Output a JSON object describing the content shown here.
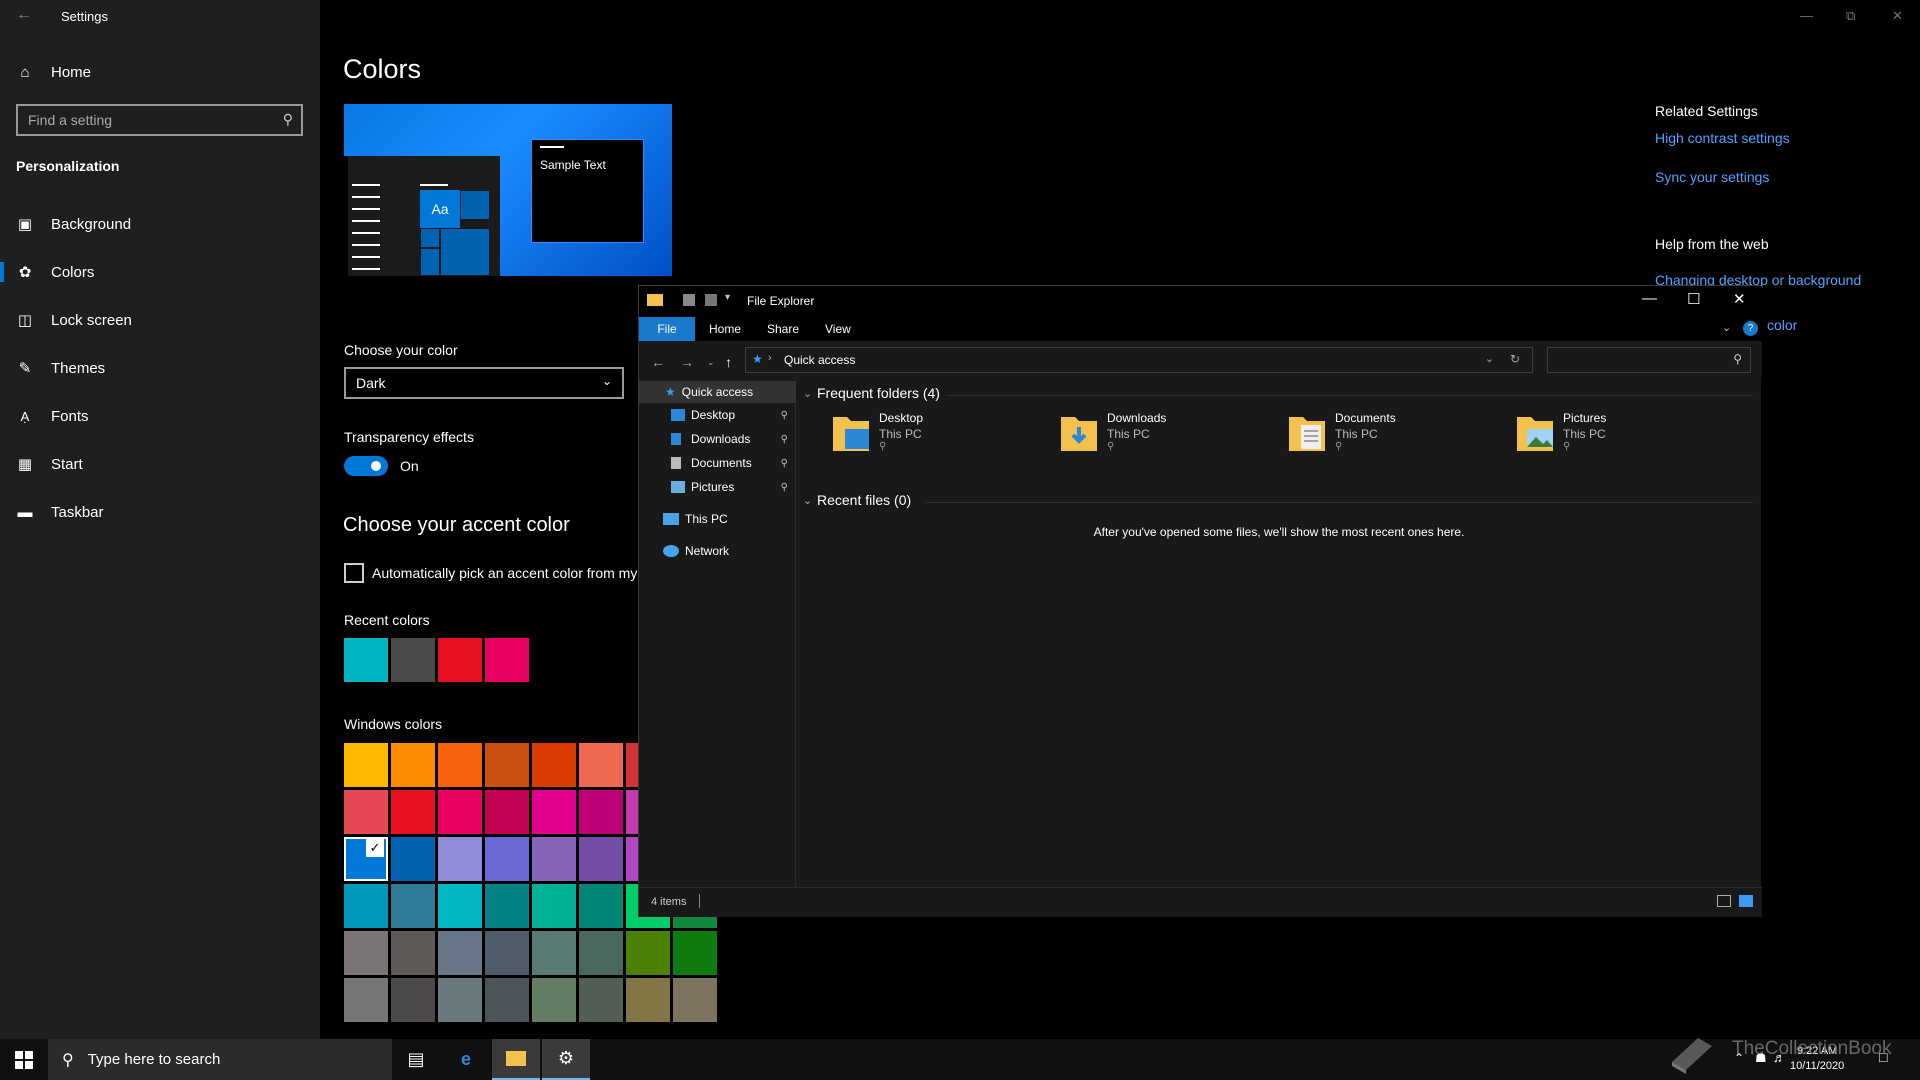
{
  "settings": {
    "window_title": "Settings",
    "home_label": "Home",
    "search_placeholder": "Find a setting",
    "section": "Personalization",
    "nav": [
      "Background",
      "Colors",
      "Lock screen",
      "Themes",
      "Fonts",
      "Start",
      "Taskbar"
    ],
    "selected_nav": "Colors",
    "page_title": "Colors",
    "preview_sample_text": "Sample Text",
    "preview_aa": "Aa",
    "choose_color_label": "Choose your color",
    "choose_color_value": "Dark",
    "transparency_label": "Transparency effects",
    "transparency_state": "On",
    "accent_title": "Choose your accent color",
    "auto_accent_label": "Automatically pick an accent color from my",
    "recent_colors_label": "Recent colors",
    "recent_colors": [
      "#00b4c4",
      "#4c4a48",
      "#e81123",
      "#ea005e"
    ],
    "windows_colors_label": "Windows colors",
    "windows_colors": [
      [
        "#ffb900",
        "#ff8c00",
        "#f7630c",
        "#ca5010",
        "#da3b01",
        "#ef6950",
        "#d13438"
      ],
      [
        "#e74856",
        "#e81123",
        "#ea005e",
        "#c30052",
        "#e3008c",
        "#bf0077",
        "#c239b3"
      ],
      [
        "#0078d7",
        "#0063b1",
        "#8e8cd8",
        "#6b69d6",
        "#8764b8",
        "#744da9",
        "#b146c2"
      ],
      [
        "#0099bc",
        "#2d7d9a",
        "#00b7c3",
        "#038387",
        "#00b294",
        "#018574",
        "#00cc6a",
        "#10893e"
      ],
      [
        "#7a7574",
        "#5d5a58",
        "#68768a",
        "#515c6b",
        "#567c73",
        "#486860",
        "#498205",
        "#107c10"
      ],
      [
        "#767676",
        "#4c4a48",
        "#69797e",
        "#4a5459",
        "#647c64",
        "#525e54",
        "#847545",
        "#7e735f"
      ]
    ],
    "selected_accent": "#0078d7",
    "related_settings_title": "Related Settings",
    "related_links": [
      "High contrast settings",
      "Sync your settings"
    ],
    "help_title": "Help from the web",
    "help_links": [
      "Changing desktop or background",
      "color"
    ]
  },
  "explorer": {
    "title": "File Explorer",
    "ribbon_tabs": [
      "File",
      "Home",
      "Share",
      "View"
    ],
    "address": "Quick access",
    "nav": {
      "quick_access": "Quick access",
      "pinned": [
        "Desktop",
        "Downloads",
        "Documents",
        "Pictures"
      ],
      "this_pc": "This PC",
      "network": "Network"
    },
    "frequent_title": "Frequent folders (4)",
    "frequent_folders": [
      {
        "name": "Desktop",
        "location": "This PC"
      },
      {
        "name": "Downloads",
        "location": "This PC"
      },
      {
        "name": "Documents",
        "location": "This PC"
      },
      {
        "name": "Pictures",
        "location": "This PC"
      }
    ],
    "recent_title": "Recent files (0)",
    "recent_empty": "After you've opened some files, we'll show the most recent ones here.",
    "status_items": "4 items"
  },
  "taskbar": {
    "search_placeholder": "Type here to search",
    "time": "9:22 AM",
    "date": "10/11/2020"
  },
  "watermark": "TheCollectionBook"
}
